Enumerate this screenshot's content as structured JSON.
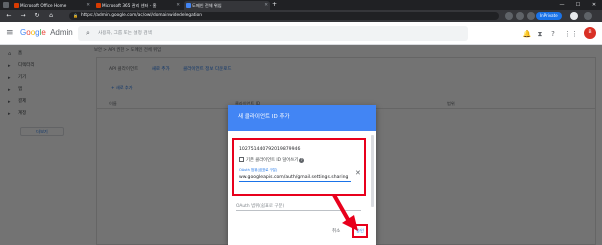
{
  "browser": {
    "tabs": [
      {
        "title": "Microsoft Office Home",
        "active": false,
        "favicon_color": "#d83b01"
      },
      {
        "title": "Microsoft 365 관리 센터 - 홈",
        "active": false,
        "favicon_color": "#d83b01"
      },
      {
        "title": "도메인 전체 위임",
        "active": true,
        "favicon_color": "#4285f4"
      }
    ],
    "url": "https://admin.google.com/ac/owl/domainwidedelegation",
    "profile_label": "InPrivate"
  },
  "admin": {
    "logo_word": [
      "G",
      "o",
      "o",
      "g",
      "l",
      "e"
    ],
    "logo_suffix": "Admin",
    "search_placeholder": "사용자, 그룹 또는 설정 검색",
    "avatar_initial": "B"
  },
  "sidebar": {
    "items": [
      {
        "label": "홈",
        "icon": "home-icon"
      },
      {
        "label": "디렉터리",
        "icon": "person-icon"
      },
      {
        "label": "기기",
        "icon": "device-icon"
      },
      {
        "label": "앱",
        "icon": "apps-icon"
      },
      {
        "label": "결제",
        "icon": "billing-icon"
      },
      {
        "label": "계정",
        "icon": "account-icon"
      }
    ],
    "more_label": "더보기"
  },
  "main": {
    "breadcrumb": "보안 > API 권한 > 도메인 전체 위임",
    "subnav": [
      "API 클라이언트",
      "새로 추가",
      "클라이언트 정보 다운로드"
    ],
    "add_button": "+ 새로 추가",
    "columns": [
      "이름",
      "클라이언트 ID",
      "범위"
    ]
  },
  "dialog": {
    "title": "새 클라이언트 ID 추가",
    "client_id": "102751440792019879946",
    "overwrite_checkbox_label": "기존 클라이언트 ID 덮어쓰기",
    "scope_label": "OAuth 범위(쉼표로 구분)",
    "scope_value": "ww.googleapis.com/auth/gmail.settings.sharing",
    "scope2_placeholder": "OAuth 범위(쉼표로 구분)",
    "cancel_label": "취소",
    "approve_label": "승인"
  },
  "colors": {
    "dialog_header": "#4285f4",
    "highlight": "#e8001c",
    "link": "#1a73e8"
  }
}
